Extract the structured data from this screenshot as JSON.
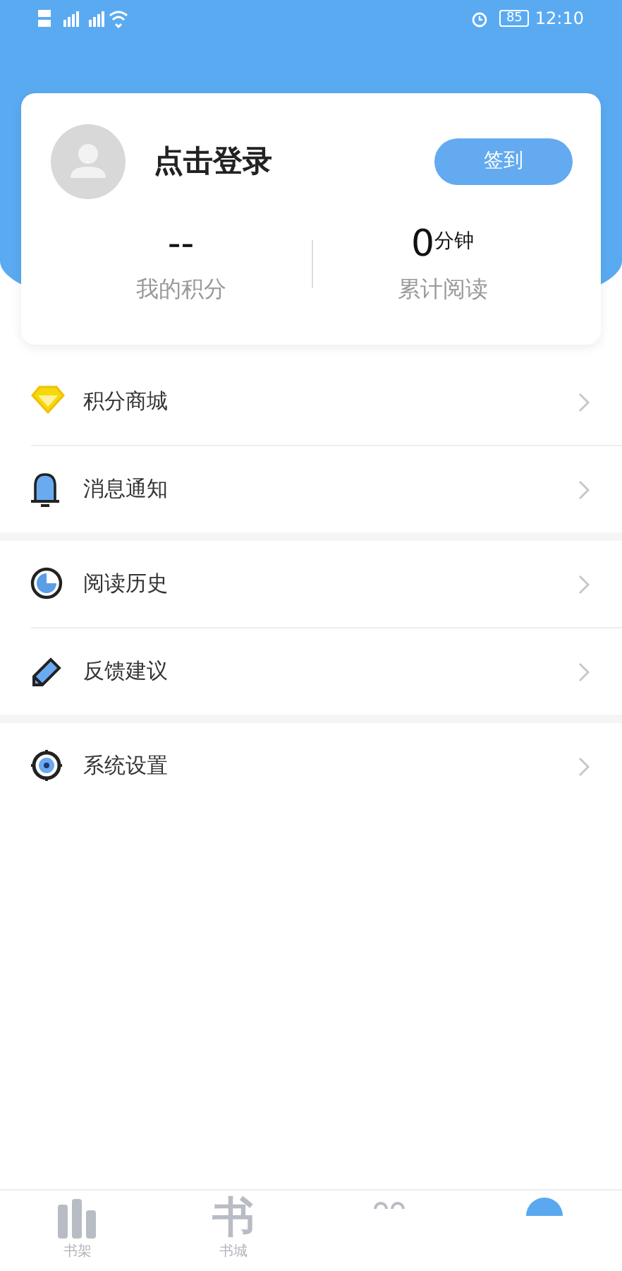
{
  "status_bar": {
    "battery": "85",
    "time": "12:10"
  },
  "profile": {
    "login_label": "点击登录",
    "checkin_button": "签到"
  },
  "stats": [
    {
      "value": "--",
      "label": "我的积分"
    },
    {
      "value": "0",
      "unit": "分钟",
      "label": "累计阅读"
    }
  ],
  "menu_groups": [
    {
      "items": [
        {
          "kind": "diamond",
          "label": "积分商城"
        },
        {
          "kind": "bell",
          "label": "消息通知"
        }
      ]
    },
    {
      "items": [
        {
          "kind": "clock",
          "label": "阅读历史"
        },
        {
          "kind": "pencil",
          "label": "反馈建议"
        }
      ]
    },
    {
      "items": [
        {
          "kind": "gear",
          "label": "系统设置"
        }
      ]
    }
  ],
  "tab_bar": [
    {
      "kind": "bars",
      "label": "书架",
      "selected": false
    },
    {
      "kind": "glyph",
      "glyph": "书",
      "label": "书城",
      "selected": false
    },
    {
      "kind": "circles",
      "selected": false
    },
    {
      "kind": "avatar",
      "selected": true
    }
  ]
}
